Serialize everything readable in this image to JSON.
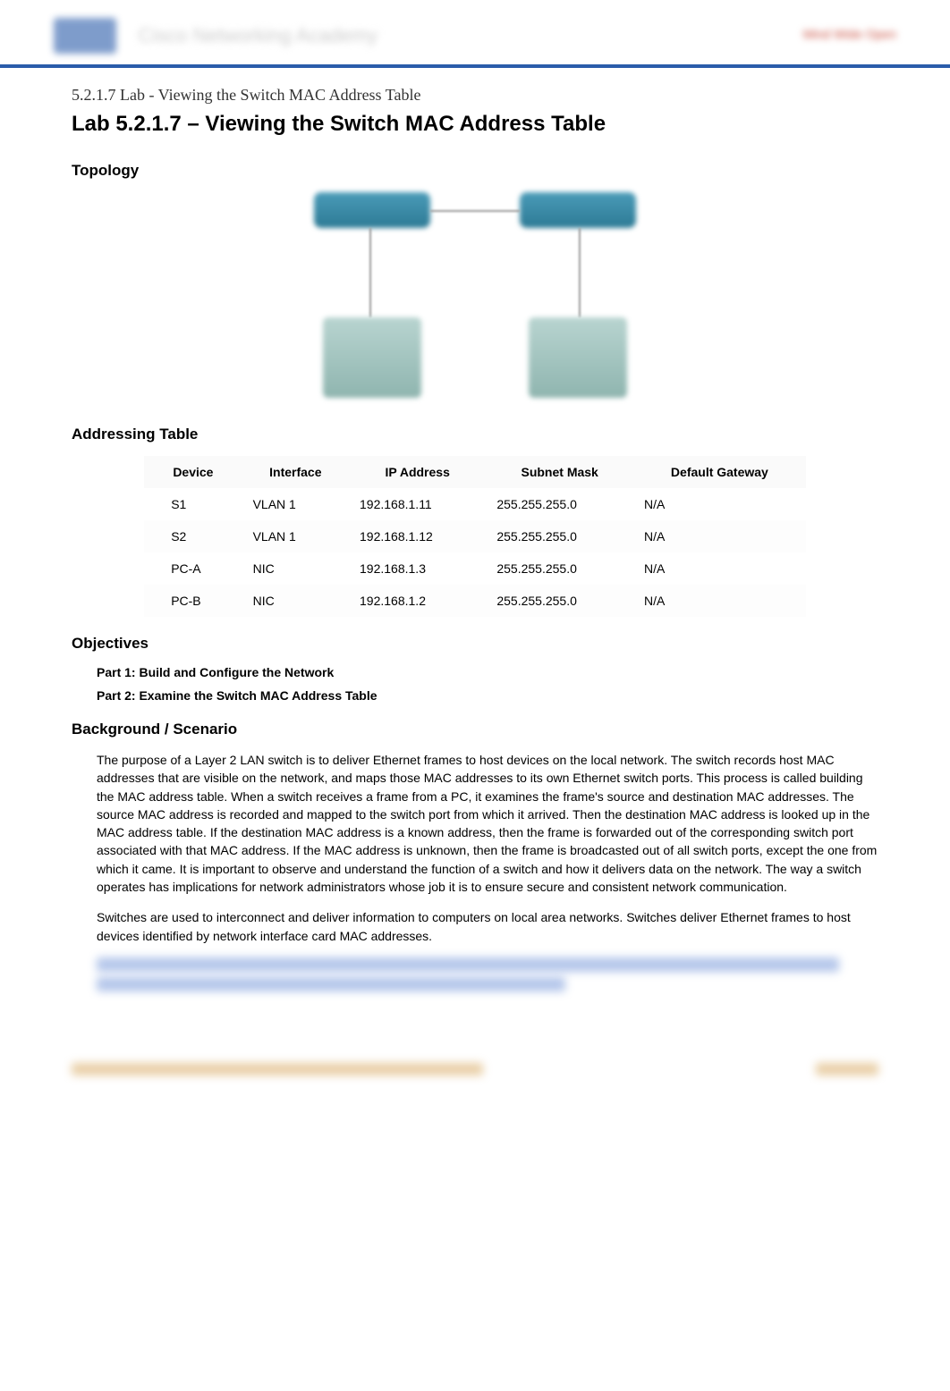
{
  "header": {
    "academy_text": "Cisco Networking Academy",
    "right_text": "Mind Wide Open"
  },
  "breadcrumb": "5.2.1.7 Lab - Viewing the Switch MAC Address Table",
  "main_title": "Lab 5.2.1.7 – Viewing the Switch MAC Address Table",
  "sections": {
    "topology": "Topology",
    "addressing_table": "Addressing Table",
    "objectives": "Objectives",
    "background": "Background / Scenario"
  },
  "addressing_table": {
    "headers": {
      "device": "Device",
      "interface": "Interface",
      "ip_address": "IP Address",
      "subnet_mask": "Subnet Mask",
      "default_gateway": "Default Gateway"
    },
    "rows": [
      {
        "device": "S1",
        "interface": "VLAN 1",
        "ip_address": "192.168.1.11",
        "subnet_mask": "255.255.255.0",
        "default_gateway": "N/A"
      },
      {
        "device": "S2",
        "interface": "VLAN 1",
        "ip_address": "192.168.1.12",
        "subnet_mask": "255.255.255.0",
        "default_gateway": "N/A"
      },
      {
        "device": "PC-A",
        "interface": "NIC",
        "ip_address": "192.168.1.3",
        "subnet_mask": "255.255.255.0",
        "default_gateway": "N/A"
      },
      {
        "device": "PC-B",
        "interface": "NIC",
        "ip_address": "192.168.1.2",
        "subnet_mask": "255.255.255.0",
        "default_gateway": "N/A"
      }
    ]
  },
  "objectives": {
    "part1": "Part 1: Build and Configure the Network",
    "part2": "Part 2: Examine the Switch MAC Address Table"
  },
  "background": {
    "para1": "The purpose of a Layer 2 LAN switch is to deliver Ethernet frames to host devices on the local network. The switch records host MAC addresses that are visible on the network, and maps those MAC addresses to its own Ethernet switch ports. This process is called building the MAC address table. When a switch receives a frame from a PC, it examines the frame's source and destination MAC addresses. The source MAC address is recorded and mapped to the switch port from which it arrived. Then the destination MAC address is looked up in the MAC address table. If the destination MAC address is a known address, then the frame is forwarded out of the corresponding switch port associated with that MAC address. If the MAC address is unknown, then the frame is broadcasted out of all switch ports, except the one from which it came. It is important to observe and understand the function of a switch and how it delivers data on the network. The way a switch operates has implications for network administrators whose job it is to ensure secure and consistent network communication.",
    "para2": "Switches are used to interconnect and deliver information to computers on local area networks. Switches deliver Ethernet frames to host devices identified by network interface card MAC addresses."
  }
}
